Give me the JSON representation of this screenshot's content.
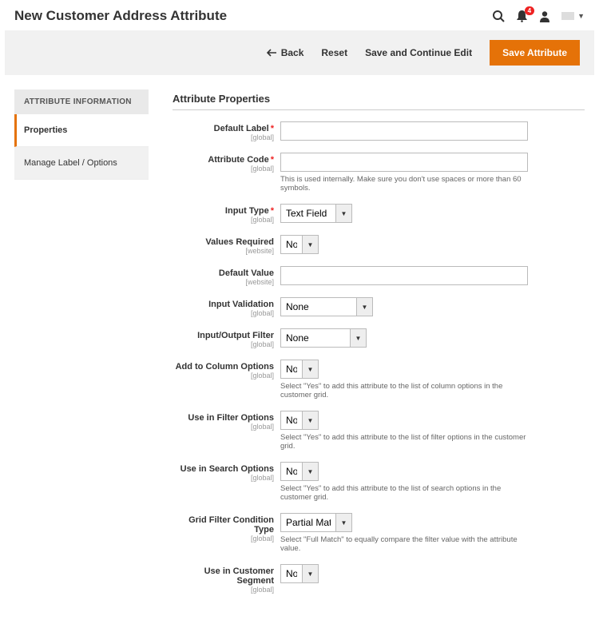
{
  "header": {
    "title": "New Customer Address Attribute",
    "notif_count": "4"
  },
  "toolbar": {
    "back": "Back",
    "reset": "Reset",
    "save_continue": "Save and Continue Edit",
    "save": "Save Attribute"
  },
  "sidebar": {
    "head": "ATTRIBUTE INFORMATION",
    "tabs": {
      "properties": "Properties",
      "manage": "Manage Label / Options"
    }
  },
  "section": {
    "title": "Attribute Properties"
  },
  "scope": {
    "global": "[global]",
    "website": "[website]"
  },
  "fields": {
    "default_label": {
      "label": "Default Label"
    },
    "attr_code": {
      "label": "Attribute Code",
      "hint": "This is used internally. Make sure you don't use spaces or more than 60 symbols."
    },
    "input_type": {
      "label": "Input Type",
      "value": "Text Field"
    },
    "values_required": {
      "label": "Values Required",
      "value": "No"
    },
    "default_value": {
      "label": "Default Value"
    },
    "input_validation": {
      "label": "Input Validation",
      "value": "None"
    },
    "io_filter": {
      "label": "Input/Output Filter",
      "value": "None"
    },
    "add_column": {
      "label": "Add to Column Options",
      "value": "No",
      "hint": "Select \"Yes\" to add this attribute to the list of column options in the customer grid."
    },
    "use_filter": {
      "label": "Use in Filter Options",
      "value": "No",
      "hint": "Select \"Yes\" to add this attribute to the list of filter options in the customer grid."
    },
    "use_search": {
      "label": "Use in Search Options",
      "value": "No",
      "hint": "Select \"Yes\" to add this attribute to the list of search options in the customer grid."
    },
    "grid_filter": {
      "label": "Grid Filter Condition Type",
      "value": "Partial Match",
      "hint": "Select \"Full Match\" to equally compare the filter value with the attribute value."
    },
    "customer_segment": {
      "label": "Use in Customer Segment",
      "value": "No"
    }
  }
}
